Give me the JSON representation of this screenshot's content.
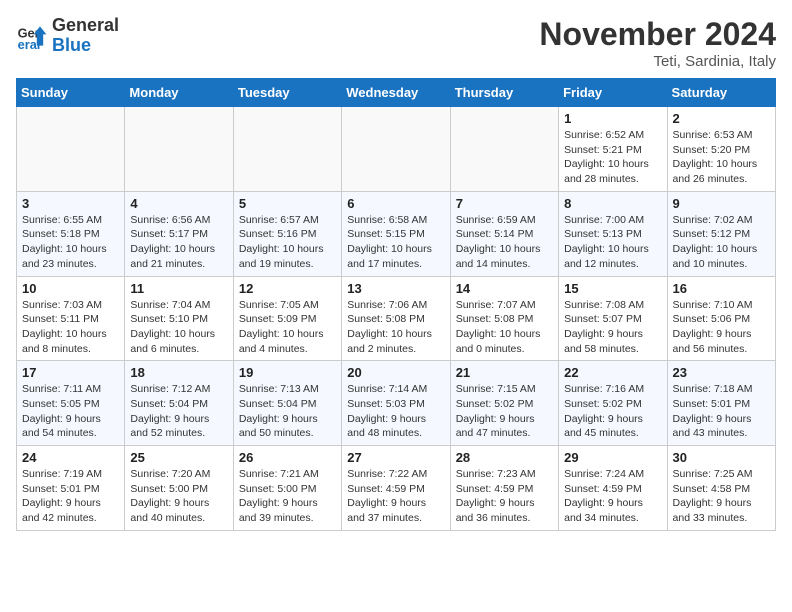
{
  "logo": {
    "line1": "General",
    "line2": "Blue"
  },
  "title": "November 2024",
  "subtitle": "Teti, Sardinia, Italy",
  "weekdays": [
    "Sunday",
    "Monday",
    "Tuesday",
    "Wednesday",
    "Thursday",
    "Friday",
    "Saturday"
  ],
  "weeks": [
    [
      {
        "day": "",
        "info": ""
      },
      {
        "day": "",
        "info": ""
      },
      {
        "day": "",
        "info": ""
      },
      {
        "day": "",
        "info": ""
      },
      {
        "day": "",
        "info": ""
      },
      {
        "day": "1",
        "info": "Sunrise: 6:52 AM\nSunset: 5:21 PM\nDaylight: 10 hours and 28 minutes."
      },
      {
        "day": "2",
        "info": "Sunrise: 6:53 AM\nSunset: 5:20 PM\nDaylight: 10 hours and 26 minutes."
      }
    ],
    [
      {
        "day": "3",
        "info": "Sunrise: 6:55 AM\nSunset: 5:18 PM\nDaylight: 10 hours and 23 minutes."
      },
      {
        "day": "4",
        "info": "Sunrise: 6:56 AM\nSunset: 5:17 PM\nDaylight: 10 hours and 21 minutes."
      },
      {
        "day": "5",
        "info": "Sunrise: 6:57 AM\nSunset: 5:16 PM\nDaylight: 10 hours and 19 minutes."
      },
      {
        "day": "6",
        "info": "Sunrise: 6:58 AM\nSunset: 5:15 PM\nDaylight: 10 hours and 17 minutes."
      },
      {
        "day": "7",
        "info": "Sunrise: 6:59 AM\nSunset: 5:14 PM\nDaylight: 10 hours and 14 minutes."
      },
      {
        "day": "8",
        "info": "Sunrise: 7:00 AM\nSunset: 5:13 PM\nDaylight: 10 hours and 12 minutes."
      },
      {
        "day": "9",
        "info": "Sunrise: 7:02 AM\nSunset: 5:12 PM\nDaylight: 10 hours and 10 minutes."
      }
    ],
    [
      {
        "day": "10",
        "info": "Sunrise: 7:03 AM\nSunset: 5:11 PM\nDaylight: 10 hours and 8 minutes."
      },
      {
        "day": "11",
        "info": "Sunrise: 7:04 AM\nSunset: 5:10 PM\nDaylight: 10 hours and 6 minutes."
      },
      {
        "day": "12",
        "info": "Sunrise: 7:05 AM\nSunset: 5:09 PM\nDaylight: 10 hours and 4 minutes."
      },
      {
        "day": "13",
        "info": "Sunrise: 7:06 AM\nSunset: 5:08 PM\nDaylight: 10 hours and 2 minutes."
      },
      {
        "day": "14",
        "info": "Sunrise: 7:07 AM\nSunset: 5:08 PM\nDaylight: 10 hours and 0 minutes."
      },
      {
        "day": "15",
        "info": "Sunrise: 7:08 AM\nSunset: 5:07 PM\nDaylight: 9 hours and 58 minutes."
      },
      {
        "day": "16",
        "info": "Sunrise: 7:10 AM\nSunset: 5:06 PM\nDaylight: 9 hours and 56 minutes."
      }
    ],
    [
      {
        "day": "17",
        "info": "Sunrise: 7:11 AM\nSunset: 5:05 PM\nDaylight: 9 hours and 54 minutes."
      },
      {
        "day": "18",
        "info": "Sunrise: 7:12 AM\nSunset: 5:04 PM\nDaylight: 9 hours and 52 minutes."
      },
      {
        "day": "19",
        "info": "Sunrise: 7:13 AM\nSunset: 5:04 PM\nDaylight: 9 hours and 50 minutes."
      },
      {
        "day": "20",
        "info": "Sunrise: 7:14 AM\nSunset: 5:03 PM\nDaylight: 9 hours and 48 minutes."
      },
      {
        "day": "21",
        "info": "Sunrise: 7:15 AM\nSunset: 5:02 PM\nDaylight: 9 hours and 47 minutes."
      },
      {
        "day": "22",
        "info": "Sunrise: 7:16 AM\nSunset: 5:02 PM\nDaylight: 9 hours and 45 minutes."
      },
      {
        "day": "23",
        "info": "Sunrise: 7:18 AM\nSunset: 5:01 PM\nDaylight: 9 hours and 43 minutes."
      }
    ],
    [
      {
        "day": "24",
        "info": "Sunrise: 7:19 AM\nSunset: 5:01 PM\nDaylight: 9 hours and 42 minutes."
      },
      {
        "day": "25",
        "info": "Sunrise: 7:20 AM\nSunset: 5:00 PM\nDaylight: 9 hours and 40 minutes."
      },
      {
        "day": "26",
        "info": "Sunrise: 7:21 AM\nSunset: 5:00 PM\nDaylight: 9 hours and 39 minutes."
      },
      {
        "day": "27",
        "info": "Sunrise: 7:22 AM\nSunset: 4:59 PM\nDaylight: 9 hours and 37 minutes."
      },
      {
        "day": "28",
        "info": "Sunrise: 7:23 AM\nSunset: 4:59 PM\nDaylight: 9 hours and 36 minutes."
      },
      {
        "day": "29",
        "info": "Sunrise: 7:24 AM\nSunset: 4:59 PM\nDaylight: 9 hours and 34 minutes."
      },
      {
        "day": "30",
        "info": "Sunrise: 7:25 AM\nSunset: 4:58 PM\nDaylight: 9 hours and 33 minutes."
      }
    ]
  ]
}
